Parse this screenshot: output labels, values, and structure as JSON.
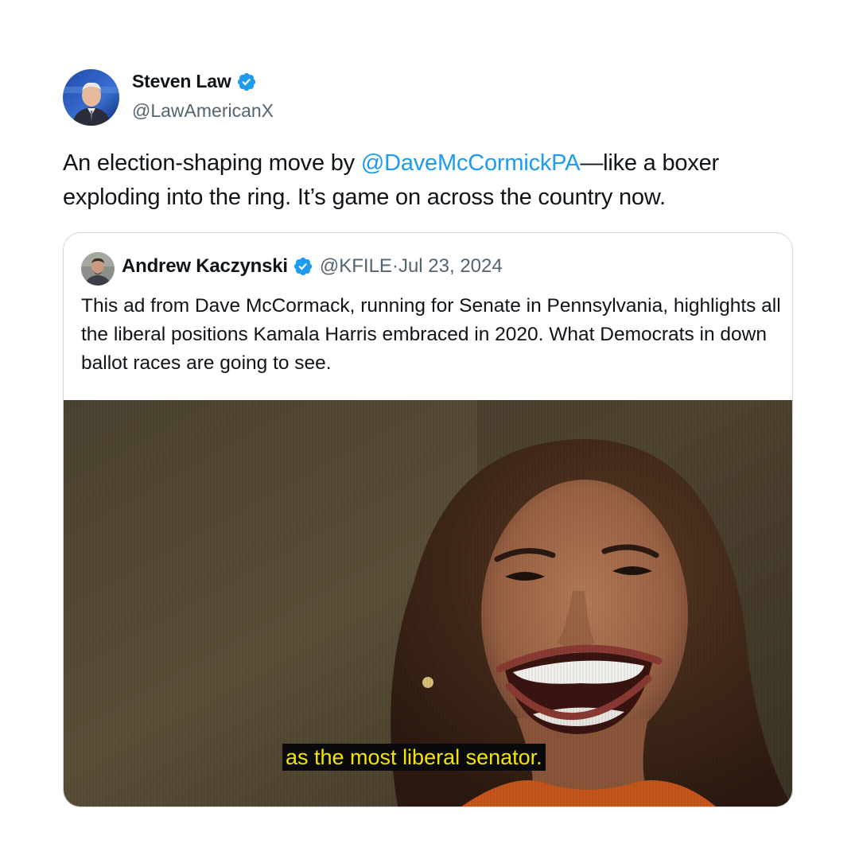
{
  "author": {
    "display_name": "Steven Law",
    "handle": "@LawAmericanX",
    "verified_icon": "verified-badge-icon",
    "avatar": "avatar"
  },
  "tweet": {
    "text_before": "An election-shaping move by ",
    "mention": "@DaveMcCormickPA",
    "text_after": "—like a boxer exploding into the ring. It’s game on across the country now."
  },
  "quoted": {
    "display_name": "Andrew Kaczynski",
    "handle": "@KFILE",
    "separator": " · ",
    "date": "Jul 23, 2024",
    "text": "This ad from Dave McCormack, running for Senate in Pennsylvania, highlights all the liberal positions Kamala Harris embraced in 2020. What Democrats in down ballot races are going to see.",
    "media_caption": "as the most liberal senator."
  },
  "colors": {
    "link": "#1d9bf0",
    "verified": "#1d9bf0",
    "secondary_text": "#536471",
    "border": "#cfd9de",
    "caption_text": "#f2e600",
    "caption_bg": "#0a0a0a"
  }
}
